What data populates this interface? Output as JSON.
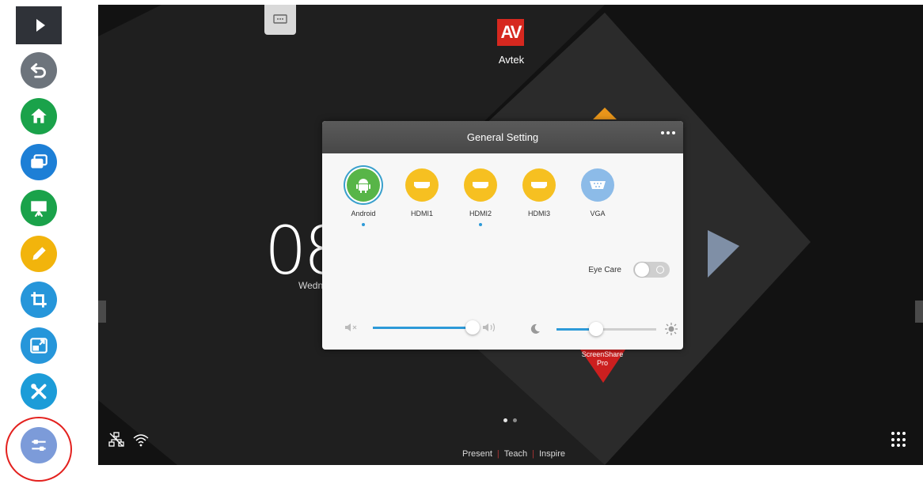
{
  "toolbar": {
    "expand_icon": "play-triangle-icon",
    "tools": [
      {
        "name": "back-icon",
        "color": "#6d747c"
      },
      {
        "name": "home-icon",
        "color": "#1aa24a"
      },
      {
        "name": "windows-icon",
        "color": "#1d7fd6"
      },
      {
        "name": "whiteboard-icon",
        "color": "#1aa24a"
      },
      {
        "name": "pen-icon",
        "color": "#f2b40c"
      },
      {
        "name": "crop-icon",
        "color": "#2696da"
      },
      {
        "name": "source-switch-icon",
        "color": "#2696da"
      },
      {
        "name": "tools-icon",
        "color": "#1c9cd8"
      },
      {
        "name": "settings-sliders-icon",
        "color": "#7c9bd9"
      }
    ],
    "highlight_color": "#e3211e"
  },
  "screen": {
    "logo": {
      "mark": "AV",
      "name": "Avtek"
    },
    "clock_partial": "08",
    "weekday_partial": "Wedn",
    "screenshare_label": "ScreenShare Pro",
    "page_dots": {
      "count": 2,
      "active": 0
    },
    "footer": [
      "Present",
      "Teach",
      "Inspire"
    ],
    "status_icons": [
      "network-icon",
      "wifi-icon"
    ]
  },
  "dialog": {
    "title": "General Setting",
    "sources": [
      {
        "label": "Android",
        "icon": "android-icon",
        "color": "#58b548",
        "selected": true,
        "signal": true
      },
      {
        "label": "HDMI1",
        "icon": "hdmi-icon",
        "color": "#f6c021",
        "selected": false,
        "signal": false
      },
      {
        "label": "HDMI2",
        "icon": "hdmi-icon",
        "color": "#f6c021",
        "selected": false,
        "signal": true
      },
      {
        "label": "HDMI3",
        "icon": "hdmi-icon",
        "color": "#f6c021",
        "selected": false,
        "signal": false
      },
      {
        "label": "VGA",
        "icon": "vga-icon",
        "color": "#8cbbe8",
        "selected": false,
        "signal": false
      }
    ],
    "eye_care": {
      "label": "Eye Care",
      "on": false
    },
    "volume": {
      "level": 1.0
    },
    "brightness": {
      "level": 0.4
    }
  }
}
